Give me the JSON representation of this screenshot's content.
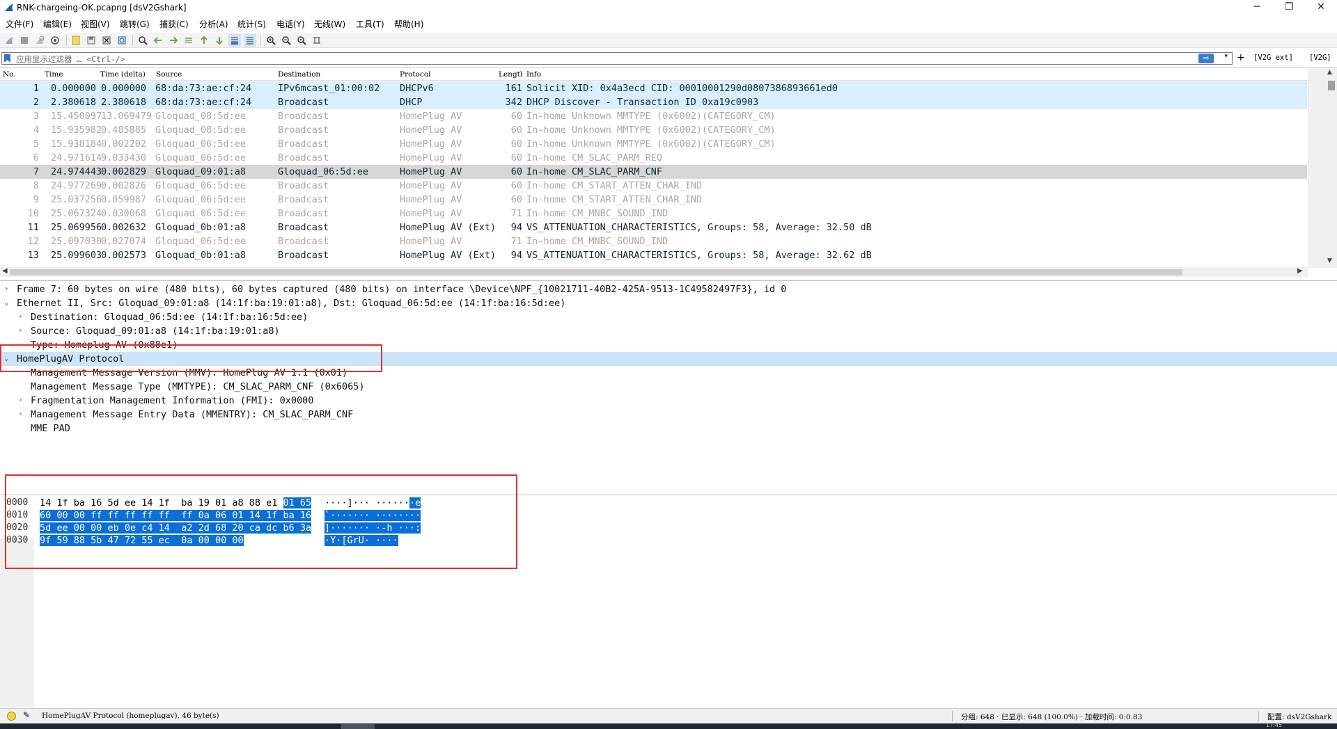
{
  "window": {
    "title": "RNK-chargeing-OK.pcapng [dsV2Gshark]",
    "minimize": "─",
    "maximize": "❐",
    "close": "✕"
  },
  "menu": [
    {
      "label": "文件(F)"
    },
    {
      "label": "编辑(E)"
    },
    {
      "label": "视图(V)"
    },
    {
      "label": "跳转(G)"
    },
    {
      "label": "捕获(C)"
    },
    {
      "label": "分析(A)"
    },
    {
      "label": "统计(S)"
    },
    {
      "label": "电话(Y)"
    },
    {
      "label": "无线(W)"
    },
    {
      "label": "工具(T)"
    },
    {
      "label": "帮助(H)"
    }
  ],
  "filter": {
    "placeholder": "应用显示过滤器 … <Ctrl-/>",
    "apply_glyph": "⇨",
    "dropdown_glyph": "▾",
    "add_label": "+",
    "buttons": [
      {
        "label": "[V2G ext]"
      },
      {
        "label": "[V2G]"
      }
    ]
  },
  "packet_list": {
    "columns": [
      "No.",
      "Time",
      "Time (delta)",
      "Source",
      "Destination",
      "Protocol",
      "Lengtl",
      "Info"
    ],
    "rows": [
      {
        "no": "1",
        "time": "0.000000",
        "delta": "0.000000",
        "src": "68:da:73:ae:cf:24",
        "dst": "IPv6mcast_01:00:02",
        "proto": "DHCPv6",
        "len": "161",
        "info": "Solicit XID: 0x4a3ecd CID: 00010001290d0807386893661ed0",
        "style": "blue"
      },
      {
        "no": "2",
        "time": "2.380618",
        "delta": "2.380618",
        "src": "68:da:73:ae:cf:24",
        "dst": "Broadcast",
        "proto": "DHCP",
        "len": "342",
        "info": "DHCP Discover - Transaction ID 0xa19c0903",
        "style": "blue"
      },
      {
        "no": "3",
        "time": "15.450097",
        "delta": "13.069479",
        "src": "Gloquad_08:5d:ee",
        "dst": "Broadcast",
        "proto": "HomePlug AV",
        "len": "60",
        "info": "In-home Unknown MMTYPE (0x6002)(CATEGORY_CM)",
        "style": "grey"
      },
      {
        "no": "4",
        "time": "15.935982",
        "delta": "0.485885",
        "src": "Gloquad_08:5d:ee",
        "dst": "Broadcast",
        "proto": "HomePlug AV",
        "len": "60",
        "info": "In-home Unknown MMTYPE (0x6002)(CATEGORY_CM)",
        "style": "grey"
      },
      {
        "no": "5",
        "time": "15.938184",
        "delta": "0.002202",
        "src": "Gloquad_06:5d:ee",
        "dst": "Broadcast",
        "proto": "HomePlug AV",
        "len": "60",
        "info": "In-home Unknown MMTYPE (0x6002)(CATEGORY_CM)",
        "style": "grey"
      },
      {
        "no": "6",
        "time": "24.971614",
        "delta": "9.033430",
        "src": "Gloquad_06:5d:ee",
        "dst": "Broadcast",
        "proto": "HomePlug AV",
        "len": "60",
        "info": "In-home CM_SLAC_PARM_REQ",
        "style": "grey"
      },
      {
        "no": "7",
        "time": "24.974443",
        "delta": "0.002829",
        "src": "Gloquad_09:01:a8",
        "dst": "Gloquad_06:5d:ee",
        "proto": "HomePlug AV",
        "len": "60",
        "info": "In-home CM_SLAC_PARM_CNF",
        "style": "selected"
      },
      {
        "no": "8",
        "time": "24.977269",
        "delta": "0.002826",
        "src": "Gloquad_06:5d:ee",
        "dst": "Broadcast",
        "proto": "HomePlug AV",
        "len": "60",
        "info": "In-home CM_START_ATTEN_CHAR_IND",
        "style": "grey"
      },
      {
        "no": "9",
        "time": "25.037256",
        "delta": "0.059987",
        "src": "Gloquad_06:5d:ee",
        "dst": "Broadcast",
        "proto": "HomePlug AV",
        "len": "60",
        "info": "In-home CM_START_ATTEN_CHAR_IND",
        "style": "grey"
      },
      {
        "no": "10",
        "time": "25.067324",
        "delta": "0.030068",
        "src": "Gloquad_06:5d:ee",
        "dst": "Broadcast",
        "proto": "HomePlug AV",
        "len": "71",
        "info": "In-home CM_MNBC_SOUND_IND",
        "style": "grey"
      },
      {
        "no": "11",
        "time": "25.069956",
        "delta": "0.002632",
        "src": "Gloquad_0b:01:a8",
        "dst": "Broadcast",
        "proto": "HomePlug AV (Ext)",
        "len": "94",
        "info": "VS_ATTENUATION_CHARACTERISTICS, Groups: 58, Average: 32.50 dB",
        "style": "dark"
      },
      {
        "no": "12",
        "time": "25.097030",
        "delta": "0.027074",
        "src": "Gloquad_06:5d:ee",
        "dst": "Broadcast",
        "proto": "HomePlug AV",
        "len": "71",
        "info": "In-home CM_MNBC_SOUND_IND",
        "style": "grey"
      },
      {
        "no": "13",
        "time": "25.099603",
        "delta": "0.002573",
        "src": "Gloquad_0b:01:a8",
        "dst": "Broadcast",
        "proto": "HomePlug AV (Ext)",
        "len": "94",
        "info": "VS_ATTENUATION_CHARACTERISTICS, Groups: 58, Average: 32.62 dB",
        "style": "dark"
      }
    ]
  },
  "details": {
    "rows": [
      {
        "indent": 0,
        "arrow": "›",
        "text": "Frame 7: 60 bytes on wire (480 bits), 60 bytes captured (480 bits) on interface \\Device\\NPF_{10021711-40B2-425A-9513-1C49582497F3}, id 0"
      },
      {
        "indent": 0,
        "arrow": "⌄",
        "text": "Ethernet II, Src: Gloquad_09:01:a8 (14:1f:ba:19:01:a8), Dst: Gloquad_06:5d:ee (14:1f:ba:16:5d:ee)"
      },
      {
        "indent": 1,
        "arrow": "›",
        "text": "Destination: Gloquad_06:5d:ee (14:1f:ba:16:5d:ee)"
      },
      {
        "indent": 1,
        "arrow": "›",
        "text": "Source: Gloquad_09:01:a8 (14:1f:ba:19:01:a8)"
      },
      {
        "indent": 1,
        "arrow": "",
        "text": "Type: Homeplug AV (0x88e1)"
      },
      {
        "indent": 0,
        "arrow": "⌄",
        "text": "HomePlugAV Protocol",
        "selected": true
      },
      {
        "indent": 1,
        "arrow": "",
        "text": "Management Message Version (MMV): HomePlug AV 1.1 (0x01)"
      },
      {
        "indent": 1,
        "arrow": "",
        "text": "Management Message Type (MMTYPE): CM_SLAC_PARM_CNF (0x6065)"
      },
      {
        "indent": 1,
        "arrow": "›",
        "text": "Fragmentation Management Information (FMI): 0x0000"
      },
      {
        "indent": 1,
        "arrow": "›",
        "text": "Management Message Entry Data (MMENTRY): CM_SLAC_PARM_CNF"
      },
      {
        "indent": 1,
        "arrow": "",
        "text": "MME PAD"
      }
    ]
  },
  "bytes": {
    "rows": [
      {
        "offset": "0000",
        "hex_plain": "14 1f ba 16 5d ee 14 1f  ba 19 01 a8 88 e1 ",
        "hex_sel": "01 65",
        "ascii_plain": "····]··· ······",
        "ascii_sel": "·e"
      },
      {
        "offset": "0010",
        "hex_plain": "",
        "hex_sel": "60 00 00 ff ff ff ff ff  ff 0a 06 01 14 1f ba 16",
        "ascii_plain": "",
        "ascii_sel": "`······· ········"
      },
      {
        "offset": "0020",
        "hex_plain": "",
        "hex_sel": "5d ee 00 00 eb 0e c4 14  a2 2d 68 20 ca dc b6 3a",
        "ascii_plain": "",
        "ascii_sel": "]······· ·-h ···:"
      },
      {
        "offset": "0030",
        "hex_plain": "",
        "hex_sel": "9f 59 88 5b 47 72 55 ec  0a 00 00 00",
        "ascii_plain": "",
        "ascii_sel": "·Y·[GrU· ····"
      }
    ]
  },
  "status": {
    "edit_glyph": "✎",
    "field_info": "HomePlugAV Protocol (homeplugav), 46 byte(s)",
    "packets": "分组: 648 · 已显示: 648 (100.0%) · 加载时间: 0:0.83",
    "profile": "配置: dsV2Gshark"
  },
  "taskbar": {
    "clock": "17:45"
  },
  "colors": {
    "row_blue": "#daeeff",
    "row_selected": "#d7d7d7",
    "detail_selected": "#cce4f7",
    "byte_highlight": "#0a6fd8",
    "annotation_red": "#e2302c",
    "minimap_green": "#c5e6cc"
  },
  "icons": [
    "shark-fin-icon",
    "start-capture-icon",
    "stop-capture-icon",
    "restart-capture-icon",
    "capture-options-icon",
    "open-file-icon",
    "save-file-icon",
    "close-file-icon",
    "reload-file-icon",
    "find-packet-icon",
    "go-back-icon",
    "go-forward-icon",
    "go-to-packet-icon",
    "go-first-icon",
    "go-last-icon",
    "autoscroll-icon",
    "colorize-icon",
    "zoom-in-icon",
    "zoom-out-icon",
    "zoom-normal-icon",
    "resize-columns-icon"
  ]
}
